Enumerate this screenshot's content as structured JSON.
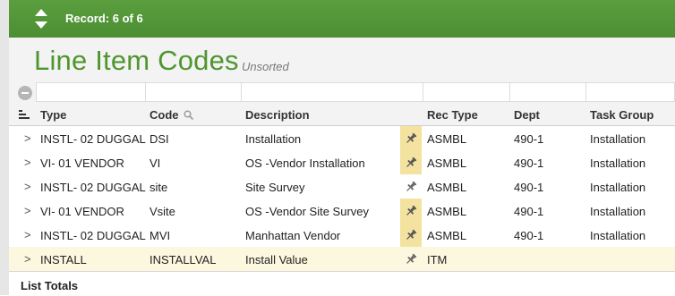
{
  "toolbar": {
    "record_label": "Record: 6 of 6"
  },
  "header": {
    "title": "Line Item Codes",
    "sort_status": "Unsorted"
  },
  "columns": [
    "Type",
    "Code",
    "Description",
    "Rec Type",
    "Dept",
    "Task Group"
  ],
  "rows": [
    {
      "type": "INSTL- 02 DUGGAL",
      "code": "DSI",
      "description": "Installation",
      "pinned": true,
      "rec_type": "ASMBL",
      "dept": "490-1",
      "task_group": "Installation"
    },
    {
      "type": "VI- 01 VENDOR",
      "code": "VI",
      "description": "OS -Vendor Installation",
      "pinned": true,
      "rec_type": "ASMBL",
      "dept": "490-1",
      "task_group": "Installation"
    },
    {
      "type": "INSTL- 02 DUGGAL",
      "code": "site",
      "description": "Site Survey",
      "pinned": false,
      "rec_type": "ASMBL",
      "dept": "490-1",
      "task_group": "Installation"
    },
    {
      "type": "VI- 01 VENDOR",
      "code": "Vsite",
      "description": "OS -Vendor Site Survey",
      "pinned": true,
      "rec_type": "ASMBL",
      "dept": "490-1",
      "task_group": "Installation"
    },
    {
      "type": "INSTL- 02 DUGGAL",
      "code": "MVI",
      "description": "Manhattan Vendor",
      "pinned": true,
      "rec_type": "ASMBL",
      "dept": "490-1",
      "task_group": "Installation"
    },
    {
      "type": "INSTALL",
      "code": "INSTALLVAL",
      "description": "Install Value",
      "pinned": false,
      "rec_type": "ITM",
      "dept": "",
      "task_group": ""
    }
  ],
  "footer": {
    "totals_label": "List Totals"
  },
  "colors": {
    "brand_green": "#4f962f",
    "topbar_green": "#4c8f33",
    "highlight_row": "#fcf8df",
    "pin_active_bg": "#f4e3a0"
  },
  "icons": {
    "record_nav": "up-down-arrows-icon",
    "filter_clear": "minus-circle-icon",
    "list_menu": "list-icon",
    "code_search": "magnifier-icon",
    "row_expand": "chevron-right-icon",
    "pin": "pushpin-icon"
  }
}
